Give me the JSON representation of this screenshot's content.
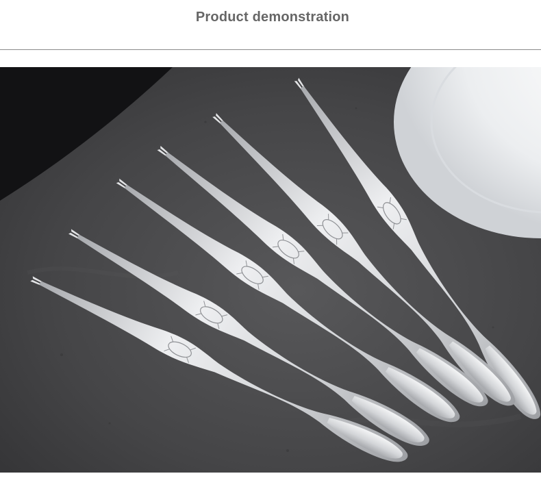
{
  "header": {
    "title": "Product demonstration"
  },
  "photo": {
    "subject": "six stainless steel seafood forks on dark slate with white plate",
    "colors": {
      "slate": "#4a4a4c",
      "slate_dark": "#2f2f31",
      "cloth": "#151517",
      "plate": "#f2f3f5",
      "steel": "#d9dadc"
    }
  }
}
